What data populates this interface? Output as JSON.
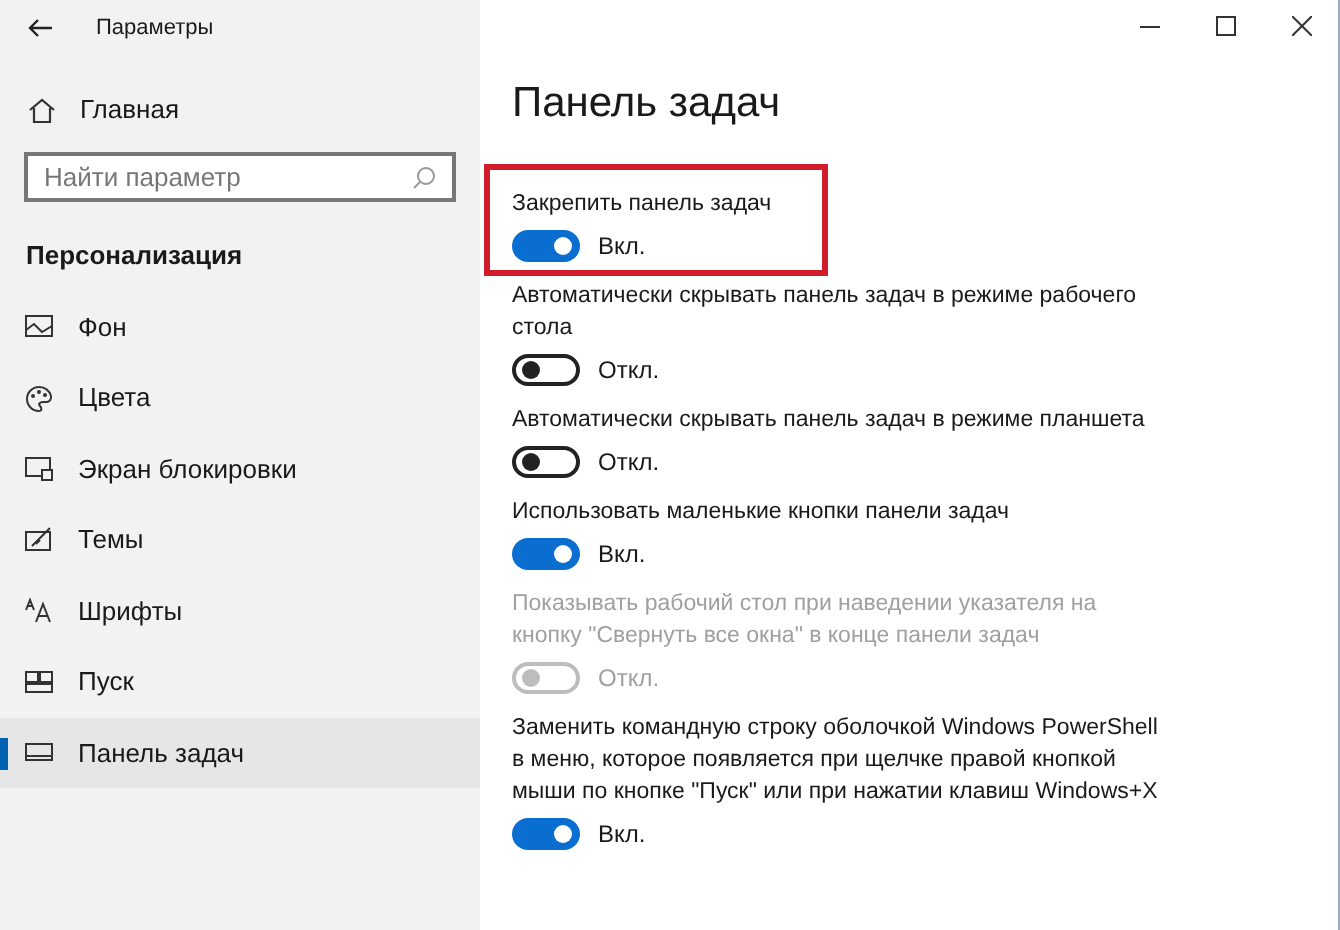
{
  "window": {
    "title": "Параметры"
  },
  "sidebar": {
    "home": "Главная",
    "search": {
      "placeholder": "Найти параметр"
    },
    "section": "Персонализация",
    "items": [
      {
        "label": "Фон",
        "selected": false
      },
      {
        "label": "Цвета",
        "selected": false
      },
      {
        "label": "Экран блокировки",
        "selected": false
      },
      {
        "label": "Темы",
        "selected": false
      },
      {
        "label": "Шрифты",
        "selected": false
      },
      {
        "label": "Пуск",
        "selected": false
      },
      {
        "label": "Панель задач",
        "selected": true
      }
    ]
  },
  "content": {
    "title": "Панель задач",
    "settings": [
      {
        "label": "Закрепить панель задач",
        "on": true,
        "state": "Вкл.",
        "disabled": false,
        "highlighted": true
      },
      {
        "label": "Автоматически скрывать панель задач в режиме рабочего стола",
        "on": false,
        "state": "Откл.",
        "disabled": false,
        "highlighted": false
      },
      {
        "label": "Автоматически скрывать панель задач в режиме планшета",
        "on": false,
        "state": "Откл.",
        "disabled": false,
        "highlighted": false
      },
      {
        "label": "Использовать маленькие кнопки панели задач",
        "on": true,
        "state": "Вкл.",
        "disabled": false,
        "highlighted": false
      },
      {
        "label": "Показывать рабочий стол при наведении указателя на кнопку \"Свернуть все окна\" в конце панели задач",
        "on": false,
        "state": "Откл.",
        "disabled": true,
        "highlighted": false
      },
      {
        "label": "Заменить командную строку оболочкой Windows PowerShell в меню, которое появляется при щелчке правой кнопкой мыши по кнопке \"Пуск\" или при нажатии клавиш Windows+X",
        "on": true,
        "state": "Вкл.",
        "disabled": false,
        "highlighted": false
      }
    ]
  }
}
